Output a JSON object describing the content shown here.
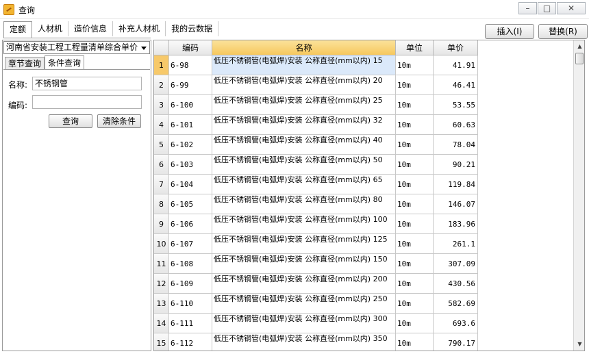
{
  "window": {
    "title": "查询",
    "min": "–",
    "max": "□",
    "close": "✕"
  },
  "top_tabs": [
    "定额",
    "人材机",
    "造价信息",
    "补充人材机",
    "我的云数据"
  ],
  "actions": {
    "insert": "插入(I)",
    "replace": "替换(R)"
  },
  "left_panel": {
    "library": "河南省安装工程工程量清单综合单价",
    "tabs": [
      "章节查询",
      "条件查询"
    ],
    "name_label": "名称:",
    "name_value": "不锈钢管",
    "code_label": "编码:",
    "code_value": "",
    "query_btn": "查询",
    "clear_btn": "清除条件"
  },
  "table": {
    "headers": [
      "",
      "编码",
      "名称",
      "单位",
      "单价"
    ],
    "rows": [
      {
        "n": "1",
        "code": "6-98",
        "name": "低压不锈钢管(电弧焊)安装 公称直径(mm以内) 15",
        "unit": "10m",
        "price": "41.91"
      },
      {
        "n": "2",
        "code": "6-99",
        "name": "低压不锈钢管(电弧焊)安装 公称直径(mm以内) 20",
        "unit": "10m",
        "price": "46.41"
      },
      {
        "n": "3",
        "code": "6-100",
        "name": "低压不锈钢管(电弧焊)安装 公称直径(mm以内) 25",
        "unit": "10m",
        "price": "53.55"
      },
      {
        "n": "4",
        "code": "6-101",
        "name": "低压不锈钢管(电弧焊)安装 公称直径(mm以内) 32",
        "unit": "10m",
        "price": "60.63"
      },
      {
        "n": "5",
        "code": "6-102",
        "name": "低压不锈钢管(电弧焊)安装 公称直径(mm以内) 40",
        "unit": "10m",
        "price": "78.04"
      },
      {
        "n": "6",
        "code": "6-103",
        "name": "低压不锈钢管(电弧焊)安装 公称直径(mm以内) 50",
        "unit": "10m",
        "price": "90.21"
      },
      {
        "n": "7",
        "code": "6-104",
        "name": "低压不锈钢管(电弧焊)安装 公称直径(mm以内) 65",
        "unit": "10m",
        "price": "119.84"
      },
      {
        "n": "8",
        "code": "6-105",
        "name": "低压不锈钢管(电弧焊)安装 公称直径(mm以内) 80",
        "unit": "10m",
        "price": "146.07"
      },
      {
        "n": "9",
        "code": "6-106",
        "name": "低压不锈钢管(电弧焊)安装 公称直径(mm以内) 100",
        "unit": "10m",
        "price": "183.96"
      },
      {
        "n": "10",
        "code": "6-107",
        "name": "低压不锈钢管(电弧焊)安装 公称直径(mm以内) 125",
        "unit": "10m",
        "price": "261.1"
      },
      {
        "n": "11",
        "code": "6-108",
        "name": "低压不锈钢管(电弧焊)安装 公称直径(mm以内) 150",
        "unit": "10m",
        "price": "307.09"
      },
      {
        "n": "12",
        "code": "6-109",
        "name": "低压不锈钢管(电弧焊)安装 公称直径(mm以内) 200",
        "unit": "10m",
        "price": "430.56"
      },
      {
        "n": "13",
        "code": "6-110",
        "name": "低压不锈钢管(电弧焊)安装 公称直径(mm以内) 250",
        "unit": "10m",
        "price": "582.69"
      },
      {
        "n": "14",
        "code": "6-111",
        "name": "低压不锈钢管(电弧焊)安装 公称直径(mm以内) 300",
        "unit": "10m",
        "price": "693.6"
      },
      {
        "n": "15",
        "code": "6-112",
        "name": "低压不锈钢管(电弧焊)安装 公称直径(mm以内) 350",
        "unit": "10m",
        "price": "790.17"
      }
    ]
  },
  "scroll": {
    "up": "▲",
    "down": "▼"
  }
}
